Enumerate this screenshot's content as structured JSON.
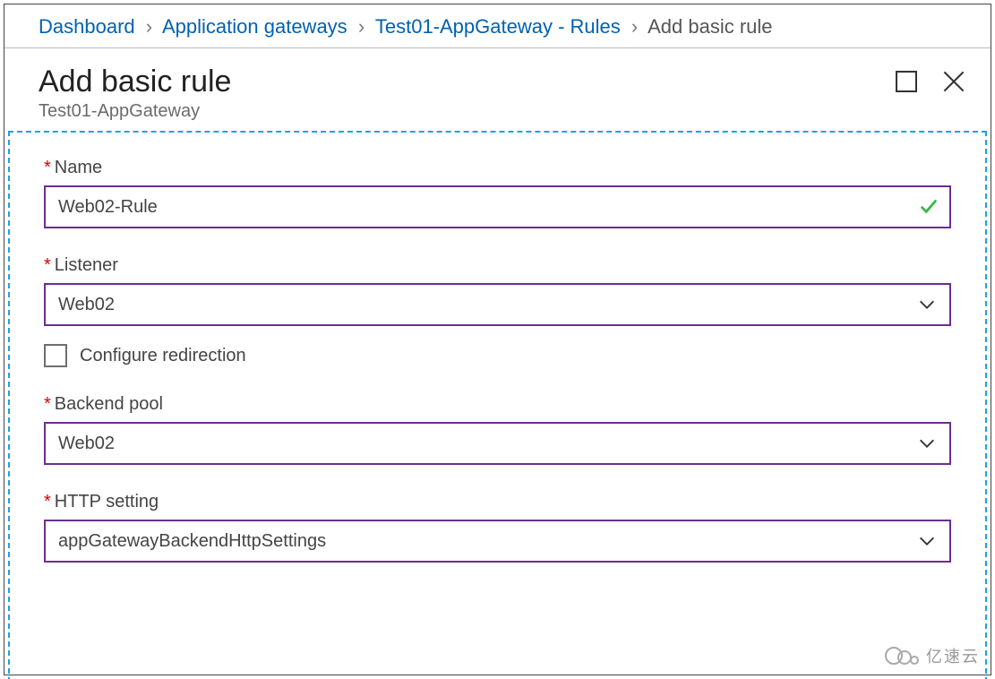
{
  "breadcrumb": {
    "items": [
      {
        "label": "Dashboard",
        "link": true
      },
      {
        "label": "Application gateways",
        "link": true
      },
      {
        "label": "Test01-AppGateway - Rules",
        "link": true
      },
      {
        "label": "Add basic rule",
        "link": false
      }
    ]
  },
  "header": {
    "title": "Add basic rule",
    "subtitle": "Test01-AppGateway"
  },
  "form": {
    "name": {
      "label": "Name",
      "value": "Web02-Rule",
      "valid": true
    },
    "listener": {
      "label": "Listener",
      "value": "Web02"
    },
    "configure_redirection": {
      "label": "Configure redirection",
      "checked": false
    },
    "backend_pool": {
      "label": "Backend pool",
      "value": "Web02"
    },
    "http_setting": {
      "label": "HTTP setting",
      "value": "appGatewayBackendHttpSettings"
    }
  },
  "watermark": "亿速云"
}
